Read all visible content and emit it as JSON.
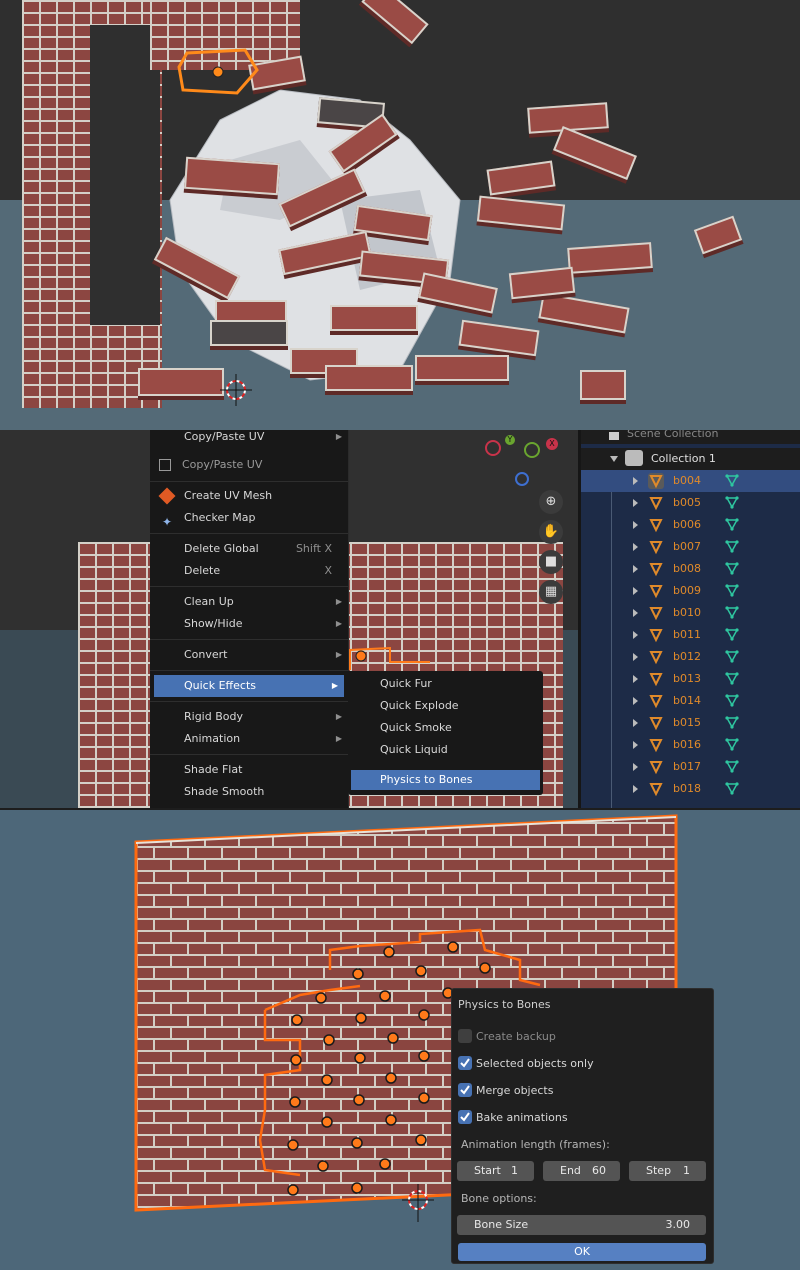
{
  "context_menu": {
    "items": [
      {
        "label": "Copy/Paste UV",
        "submenu": true
      },
      {
        "label": "Copy/Paste UV"
      },
      {
        "label": "Create UV Mesh"
      },
      {
        "label": "Checker Map"
      },
      {
        "label": "Delete Global",
        "shortcut": "Shift X"
      },
      {
        "label": "Delete",
        "shortcut": "X"
      },
      {
        "label": "Clean Up",
        "submenu": true
      },
      {
        "label": "Show/Hide",
        "submenu": true
      },
      {
        "label": "Convert",
        "submenu": true
      },
      {
        "label": "Quick Effects",
        "submenu": true,
        "highlighted": true
      },
      {
        "label": "Rigid Body",
        "submenu": true
      },
      {
        "label": "Animation",
        "submenu": true
      },
      {
        "label": "Shade Flat"
      },
      {
        "label": "Shade Smooth"
      }
    ]
  },
  "quick_effects_submenu": {
    "items": [
      "Quick Fur",
      "Quick Explode",
      "Quick Smoke",
      "Quick Liquid",
      "Physics to Bones"
    ]
  },
  "gizmo": {
    "y_label": "Y",
    "x_label": "X"
  },
  "outliner": {
    "scene_collection": "Scene Collection",
    "collection": "Collection 1",
    "objects": [
      "b004",
      "b005",
      "b006",
      "b007",
      "b008",
      "b009",
      "b010",
      "b011",
      "b012",
      "b013",
      "b014",
      "b015",
      "b016",
      "b017",
      "b018"
    ],
    "selected": "b004"
  },
  "dialog": {
    "title": "Physics to Bones",
    "create_backup": {
      "label": "Create backup",
      "checked": false
    },
    "selected_only": {
      "label": "Selected objects only",
      "checked": true
    },
    "merge_objects": {
      "label": "Merge objects",
      "checked": true
    },
    "bake_animations": {
      "label": "Bake animations",
      "checked": true
    },
    "anim_length_label": "Animation length (frames):",
    "start": {
      "label": "Start",
      "value": "1"
    },
    "end": {
      "label": "End",
      "value": "60"
    },
    "step": {
      "label": "Step",
      "value": "1"
    },
    "bone_options_label": "Bone options:",
    "bone_size": {
      "label": "Bone Size",
      "value": "3.00"
    },
    "ok_label": "OK"
  },
  "colors": {
    "accent": "#4772b3",
    "selection": "#ff7a1a",
    "outliner_text": "#e08a2a"
  }
}
